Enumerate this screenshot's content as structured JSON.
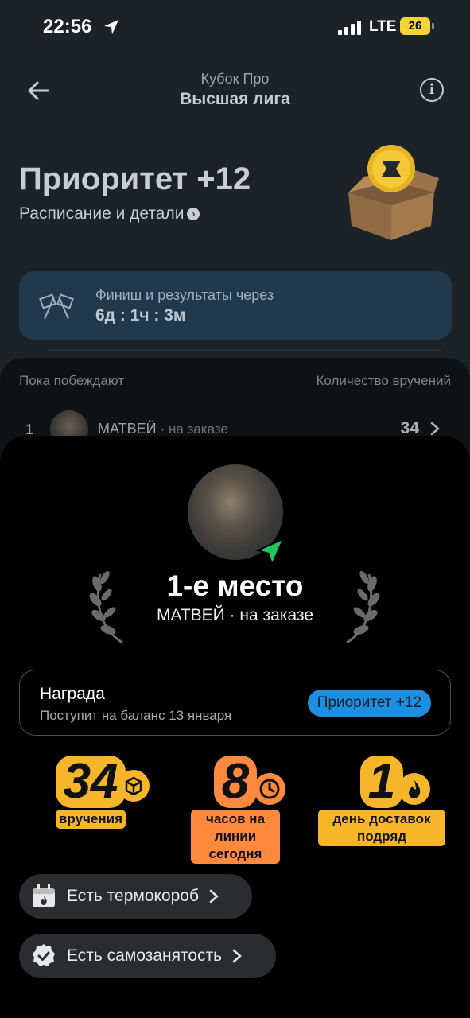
{
  "status_bar": {
    "time": "22:56",
    "network": "LTE",
    "battery": "26"
  },
  "header": {
    "subtitle": "Кубок Про",
    "title": "Высшая лига",
    "info_icon": "i"
  },
  "promo": {
    "title": "Приоритет +12",
    "schedule_link": "Расписание и детали"
  },
  "finish": {
    "label": "Финиш и результаты через",
    "countdown": "6д : 1ч : 3м"
  },
  "leaderboard": {
    "col_left": "Пока побеждают",
    "col_right": "Количество вручений",
    "rows": [
      {
        "rank": "1",
        "name": "МАТВЕЙ",
        "status": "· на заказе",
        "count": "34"
      }
    ]
  },
  "sheet": {
    "place": "1-е место",
    "subtitle": "МАТВЕЙ · на заказе",
    "reward": {
      "title": "Награда",
      "subtitle": "Поступит на баланс 13 января",
      "pill": "Приоритет +12"
    },
    "stats": [
      {
        "value": "34",
        "label": "вручения",
        "icon": "box-icon",
        "color": "#f7b52a"
      },
      {
        "value": "8",
        "label": "часов на линии сегодня",
        "icon": "clock-icon",
        "color": "#ff8a3d"
      },
      {
        "value": "1",
        "label": "день доставок подряд",
        "icon": "flame-icon",
        "color": "#f7b52a"
      }
    ],
    "chips": [
      {
        "label": "Есть термокороб",
        "icon": "thermobox-icon"
      },
      {
        "label": "Есть самозанятость",
        "icon": "verified-icon"
      }
    ]
  },
  "colors": {
    "accent_blue": "#1d8fe0",
    "nav_green": "#22c55e",
    "battery_yellow": "#f2d534"
  }
}
